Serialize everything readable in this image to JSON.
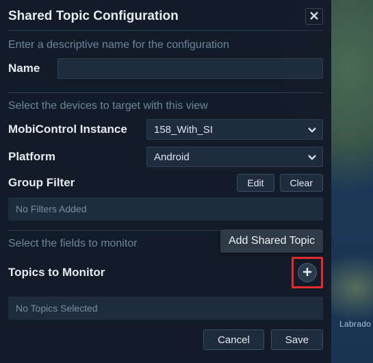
{
  "map": {
    "label": "Labrado"
  },
  "panel": {
    "title": "Shared Topic Configuration",
    "name_section": {
      "hint": "Enter a descriptive name for the configuration",
      "label": "Name",
      "value": ""
    },
    "target_section": {
      "hint": "Select the devices to target with this view",
      "instance_label": "MobiControl Instance",
      "instance_value": "158_With_SI",
      "platform_label": "Platform",
      "platform_value": "Android",
      "group_filter_label": "Group Filter",
      "edit_label": "Edit",
      "clear_label": "Clear",
      "group_filter_status": "No Filters Added"
    },
    "monitor_section": {
      "hint": "Select the fields to monitor",
      "topics_label": "Topics to Monitor",
      "add_tooltip": "Add Shared Topic",
      "topics_status": "No Topics Selected"
    },
    "footer": {
      "cancel": "Cancel",
      "save": "Save"
    }
  }
}
